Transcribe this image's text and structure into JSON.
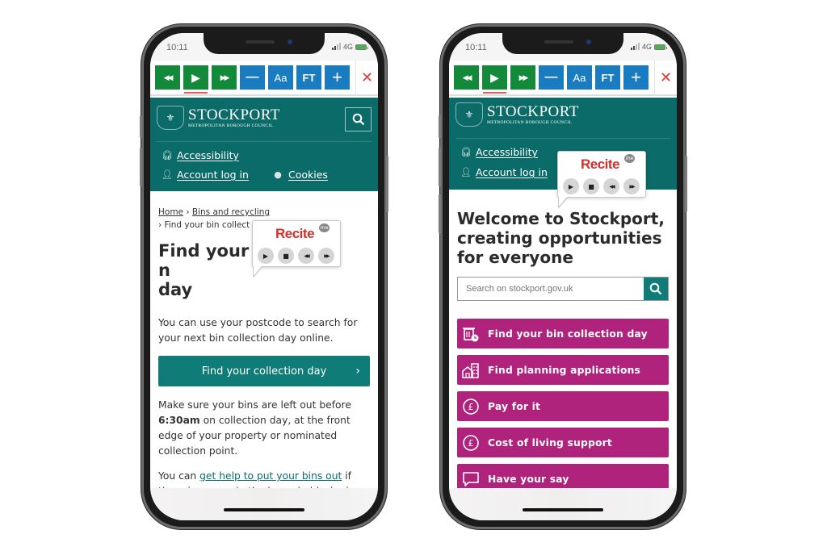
{
  "status": {
    "time": "10:11",
    "network": "4G"
  },
  "toolbar": {
    "buttons": [
      {
        "name": "rewind",
        "glyph": "◀◀",
        "color": "#138a3a"
      },
      {
        "name": "play",
        "glyph": "▶",
        "color": "#138a3a",
        "active": true
      },
      {
        "name": "fast-forward",
        "glyph": "▶▶",
        "color": "#138a3a"
      },
      {
        "name": "decrease-text",
        "glyph": "—",
        "color": "#1a7cc0"
      },
      {
        "name": "font-settings",
        "glyph": "Aa",
        "color": "#1a7cc0"
      },
      {
        "name": "font-type",
        "glyph": "FT",
        "color": "#1a7cc0"
      },
      {
        "name": "increase-text",
        "glyph": "+",
        "color": "#1a7cc0"
      }
    ],
    "close_glyph": "✕"
  },
  "brand": {
    "name": "STOCKPORT",
    "subtitle": "METROPOLITAN BOROUGH COUNCIL",
    "color": "#0b6b69"
  },
  "header_links": {
    "accessibility": "Accessibility",
    "account": "Account log in",
    "cookies": "Cookies"
  },
  "recite": {
    "logo": "Recite",
    "badge": "me",
    "controls": [
      "▶",
      "■",
      "◀◀",
      "▶▶"
    ]
  },
  "left_page": {
    "breadcrumb": {
      "home": "Home",
      "sep": "›",
      "section": "Bins and recycling",
      "current": "Find your bin collect"
    },
    "title": "Find your bin collection day",
    "title_line1": "Find your b",
    "title_line1_end": "n",
    "title_line2": "day",
    "intro": "You can use your postcode to search for your next bin collection day online.",
    "cta_label": "Find your collection day",
    "cta_chevron": "›",
    "notice_pre": "Make sure your bins are left out before ",
    "notice_bold": "6:30am",
    "notice_post": " on collection day, at the front edge of your property or nominated collection point.",
    "help_pre": "You can ",
    "help_link": "get help to put your bins out",
    "help_post": " if there is no one in the household who is"
  },
  "right_page": {
    "title": "Welcome to Stockport, creating opportunities for everyone",
    "search_placeholder": "Search on stockport.gov.uk",
    "tile_color": "#b0237d",
    "tiles": [
      {
        "label": "Find your bin collection day",
        "icon": "bin-clock"
      },
      {
        "label": "Find planning applications",
        "icon": "house-building"
      },
      {
        "label": "Pay for it",
        "icon": "pound-circle"
      },
      {
        "label": "Cost of living support",
        "icon": "pound-circle"
      },
      {
        "label": "Have your say",
        "icon": "speech-bubble"
      }
    ]
  }
}
